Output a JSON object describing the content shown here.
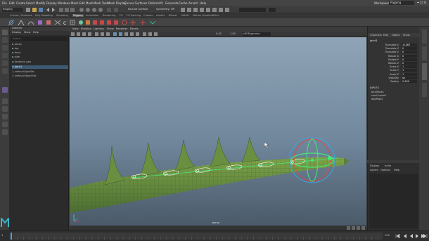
{
  "menubar": {
    "items": [
      "File",
      "Edit",
      "Create",
      "Select",
      "Modify",
      "Display",
      "Windows",
      "Mesh",
      "Edit Mesh",
      "Mesh Tools",
      "Mesh Display",
      "Curves",
      "Surfaces",
      "Deform",
      "UV",
      "Generate",
      "Cache",
      "Arnold",
      "Help"
    ],
    "workspace_label": "Workspace:",
    "workspace_value": "Rigging"
  },
  "statusline": {
    "mode": "Rigging",
    "live_surface": "No Live Surface",
    "symmetry": "Symmetry: Off",
    "object_field": "",
    "login": ""
  },
  "shelf": {
    "tabs": [
      "Curves / Surfaces",
      "Poly Modeling",
      "Sculpting",
      "Rigging",
      "Animation",
      "Rendering",
      "FX",
      "FX Caching",
      "Custom",
      "Arnold",
      "Bifrost",
      "MASH",
      "Motion Graphics",
      "XGen"
    ],
    "active_tab": "Rigging"
  },
  "outliner": {
    "title": "Outliner",
    "menu": [
      "Display",
      "Show",
      "Help"
    ],
    "search_placeholder": "Search...",
    "rows": [
      {
        "name": "persp",
        "type": "camera"
      },
      {
        "name": "top",
        "type": "camera"
      },
      {
        "name": "front",
        "type": "camera"
      },
      {
        "name": "side",
        "type": "camera"
      },
      {
        "name": "tentacle_geo",
        "type": "mesh"
      },
      {
        "name": "joint1",
        "type": "joint",
        "selected": true
      },
      {
        "name": "defaultLightSet",
        "type": "set"
      },
      {
        "name": "defaultObjectSet",
        "type": "set"
      }
    ]
  },
  "viewport": {
    "menu": [
      "View",
      "Shading",
      "Lighting",
      "Show",
      "Renderer",
      "Panels"
    ],
    "exposure": "0.00",
    "gamma": "1.00",
    "colorspace": "sRGB gamma",
    "camera_label": "persp"
  },
  "channelbox": {
    "menu": [
      "Channels",
      "Edit",
      "Object",
      "Show"
    ],
    "object_name": "joint1",
    "attributes": [
      {
        "name": "Translate X",
        "value": "-6.487"
      },
      {
        "name": "Translate Y",
        "value": "0"
      },
      {
        "name": "Translate Z",
        "value": "0"
      },
      {
        "name": "Rotate X",
        "value": "0"
      },
      {
        "name": "Rotate Y",
        "value": "0"
      },
      {
        "name": "Rotate Z",
        "value": "0"
      },
      {
        "name": "Scale X",
        "value": "1"
      },
      {
        "name": "Scale Y",
        "value": "1"
      },
      {
        "name": "Scale Z",
        "value": "1"
      },
      {
        "name": "Visibility",
        "value": "on"
      },
      {
        "name": "Radius",
        "value": "0.650"
      }
    ],
    "section_header": "INPUTS",
    "inputs": [
      "bindPose1",
      "skinCluster1",
      "dagPose1"
    ]
  },
  "layers": {
    "tabs": [
      "Display",
      "Anim"
    ],
    "menu": [
      "Layers",
      "Options",
      "Help"
    ]
  },
  "timeline": {
    "start_frame": "1",
    "end_frame": "120",
    "current_frame": "1"
  },
  "colors": {
    "accent_blue": "#5285a6",
    "selection_green": "#44e87a",
    "mesh_olive": "#5f8a3c",
    "viewport_sky": "#7f96aa",
    "viewport_ground": "#4f5f6e"
  }
}
